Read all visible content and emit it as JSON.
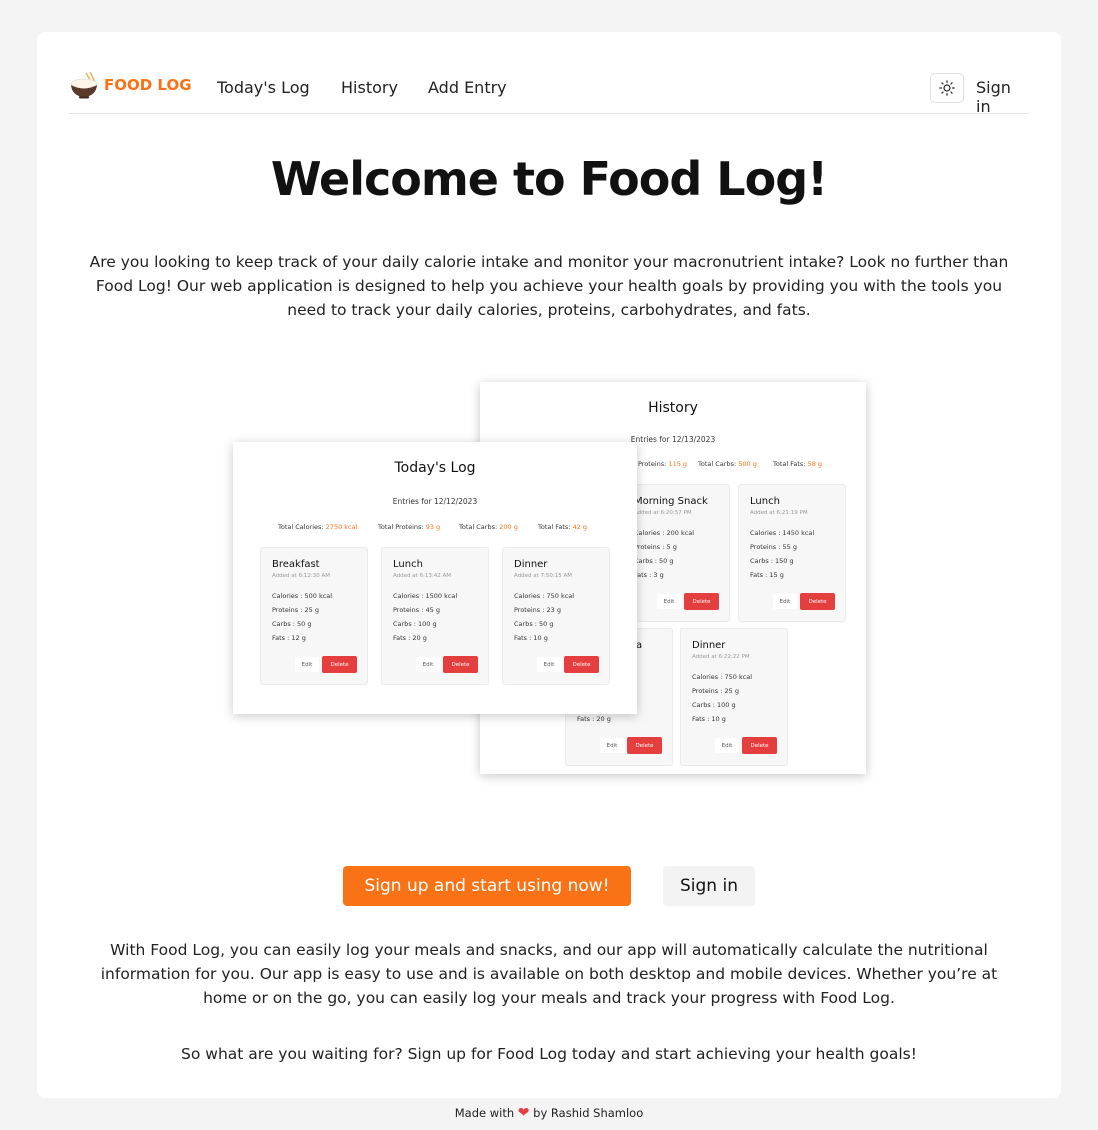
{
  "header": {
    "logo_text": "FOOD LOG",
    "nav": [
      "Today's Log",
      "History",
      "Add Entry"
    ],
    "theme_icon": "sun-icon",
    "signin": "Sign in"
  },
  "hero": {
    "title": "Welcome to Food Log!",
    "intro": "Are you looking to keep track of your daily calorie intake and monitor your macronutrient intake? Look no further than Food Log! Our web application is designed to help you achieve your health goals by providing you with the tools you need to track your daily calories, proteins, carbohydrates, and fats."
  },
  "history_shot": {
    "title": "History",
    "subtitle": "Entries for 12/13/2023",
    "stats": [
      {
        "label": "Proteins: ",
        "value": "115 g"
      },
      {
        "label": "Total Carbs: ",
        "value": "500 g"
      },
      {
        "label": "Total Fats: ",
        "value": "58 g"
      }
    ],
    "meals": [
      {
        "name": "Morning Snack",
        "added": "Added at 6:20:57 PM",
        "lines": [
          "Calories : 200 kcal",
          "Proteins : 5 g",
          "Carbs : 50 g",
          "Fats : 3 g"
        ],
        "edit": "Edit",
        "delete": "Delete"
      },
      {
        "name": "Lunch",
        "added": "Added at 6:21:19 PM",
        "lines": [
          "Calories : 1450 kcal",
          "Proteins : 55 g",
          "Carbs : 150 g",
          "Fats : 15 g"
        ],
        "edit": "Edit",
        "delete": "Delete"
      },
      {
        "name": "a",
        "added": "",
        "lines": [
          "Fats : 20 g"
        ],
        "edit": "Edit",
        "delete": "Delete"
      },
      {
        "name": "Dinner",
        "added": "Added at 6:22:22 PM",
        "lines": [
          "Calories : 750 kcal",
          "Proteins : 25 g",
          "Carbs : 100 g",
          "Fats : 10 g"
        ],
        "edit": "Edit",
        "delete": "Delete"
      }
    ]
  },
  "today_shot": {
    "title": "Today's Log",
    "subtitle": "Entries for 12/12/2023",
    "stats": [
      {
        "label": "Total Calories: ",
        "value": "2750 kcal"
      },
      {
        "label": "Total Proteins: ",
        "value": "93 g"
      },
      {
        "label": "Total Carbs: ",
        "value": "200 g"
      },
      {
        "label": "Total Fats: ",
        "value": "42 g"
      }
    ],
    "meals": [
      {
        "name": "Breakfast",
        "added": "Added at 6:12:30 AM",
        "lines": [
          "Calories : 500 kcal",
          "Proteins : 25 g",
          "Carbs : 50 g",
          "Fats : 12 g"
        ],
        "edit": "Edit",
        "delete": "Delete"
      },
      {
        "name": "Lunch",
        "added": "Added at 6:13:42 AM",
        "lines": [
          "Calories : 1500 kcal",
          "Proteins : 45 g",
          "Carbs : 100 g",
          "Fats : 20 g"
        ],
        "edit": "Edit",
        "delete": "Delete"
      },
      {
        "name": "Dinner",
        "added": "Added at 7:50:15 AM",
        "lines": [
          "Calories : 750 kcal",
          "Proteins : 23 g",
          "Carbs : 50 g",
          "Fats : 10 g"
        ],
        "edit": "Edit",
        "delete": "Delete"
      }
    ]
  },
  "cta": {
    "primary": "Sign up and start using now!",
    "secondary": "Sign in"
  },
  "body": {
    "paragraph": "With Food Log, you can easily log your meals and snacks, and our app will automatically calculate the nutritional information for you. Our app is easy to use and is available on both desktop and mobile devices. Whether you’re at home or on the go, you can easily log your meals and track your progress with Food Log.",
    "closing": "So what are you waiting for? Sign up for Food Log today and start achieving your health goals!"
  },
  "footer": {
    "prefix": "Made with",
    "suffix": "by Rashid Shamloo",
    "heart_icon": "heart-icon"
  },
  "colors": {
    "accent": "#f97316",
    "danger": "#e53e3e"
  }
}
